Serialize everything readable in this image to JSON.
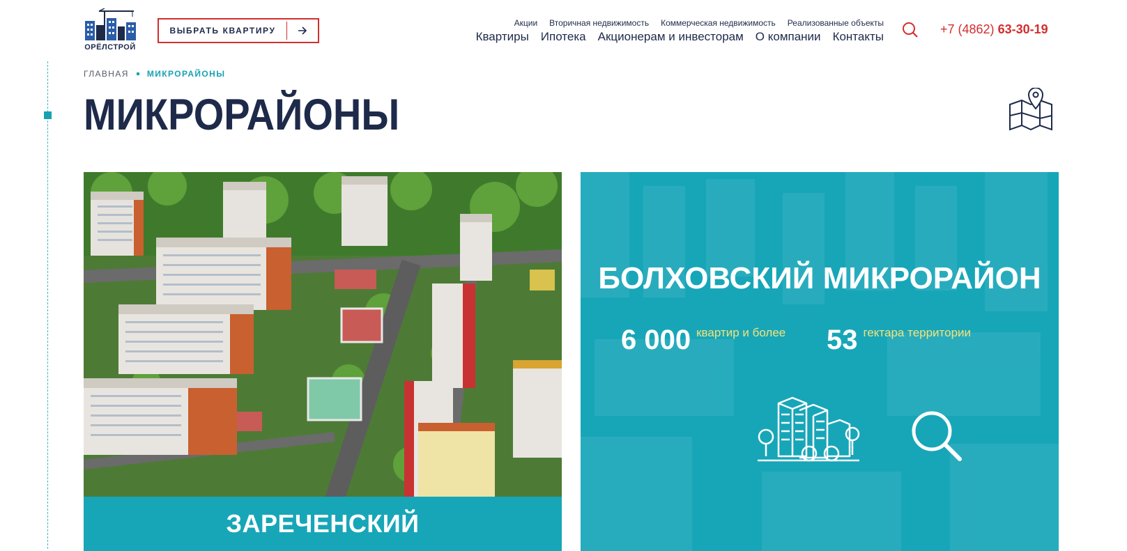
{
  "brand": {
    "logo_text": "ОРЁЛСТРОЙ"
  },
  "header": {
    "cta_label": "ВЫБРАТЬ КВАРТИРУ",
    "subnav": [
      "Акции",
      "Вторичная недвижимость",
      "Коммерческая недвижимость",
      "Реализованные объекты"
    ],
    "mainnav": [
      "Квартиры",
      "Ипотека",
      "Акционерам и инвесторам",
      "О компании",
      "Контакты"
    ],
    "phone_prefix": "+7 (4862) ",
    "phone_number": "63-30-19"
  },
  "breadcrumb": {
    "home": "ГЛАВНАЯ",
    "current": "МИКРОРАЙОНЫ"
  },
  "page_title": "МИКРОРАЙОНЫ",
  "cards": {
    "left": {
      "caption": "ЗАРЕЧЕНСКИЙ"
    },
    "right": {
      "title": "БОЛХОВСКИЙ МИКРОРАЙОН",
      "stat1_value": "6 000",
      "stat1_label": "квартир и более",
      "stat2_value": "53",
      "stat2_label": "гектара территории"
    }
  },
  "colors": {
    "accent_red": "#d22e2e",
    "teal": "#17a6b8",
    "navy": "#1e2a4a",
    "stat_label": "#f5e27a"
  },
  "icons": [
    "search-icon",
    "arrow-right-icon",
    "map-pin-icon",
    "buildings-icon",
    "magnifier-icon"
  ]
}
